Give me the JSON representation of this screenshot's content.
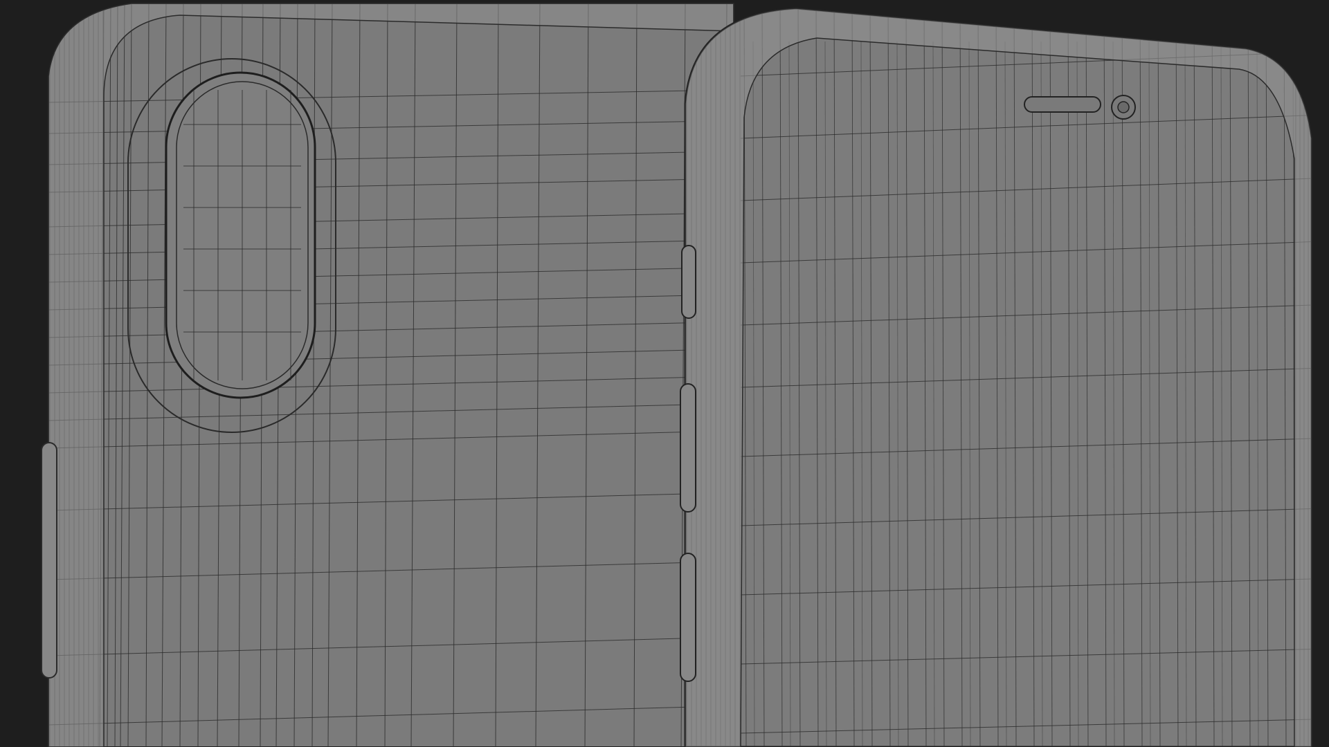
{
  "scene": {
    "description_visible_text": "",
    "background_color": "#1e1e1e",
    "shell_fill": "#7b7b7b",
    "rim_fill": "#8a8a8a",
    "wire_color": "#2a2a2a",
    "objects": [
      {
        "name": "phone-back",
        "view": "rear",
        "features": [
          "camera-bump",
          "side-button"
        ]
      },
      {
        "name": "phone-front",
        "view": "front",
        "features": [
          "earpiece",
          "front-camera",
          "side-buttons"
        ]
      }
    ]
  }
}
